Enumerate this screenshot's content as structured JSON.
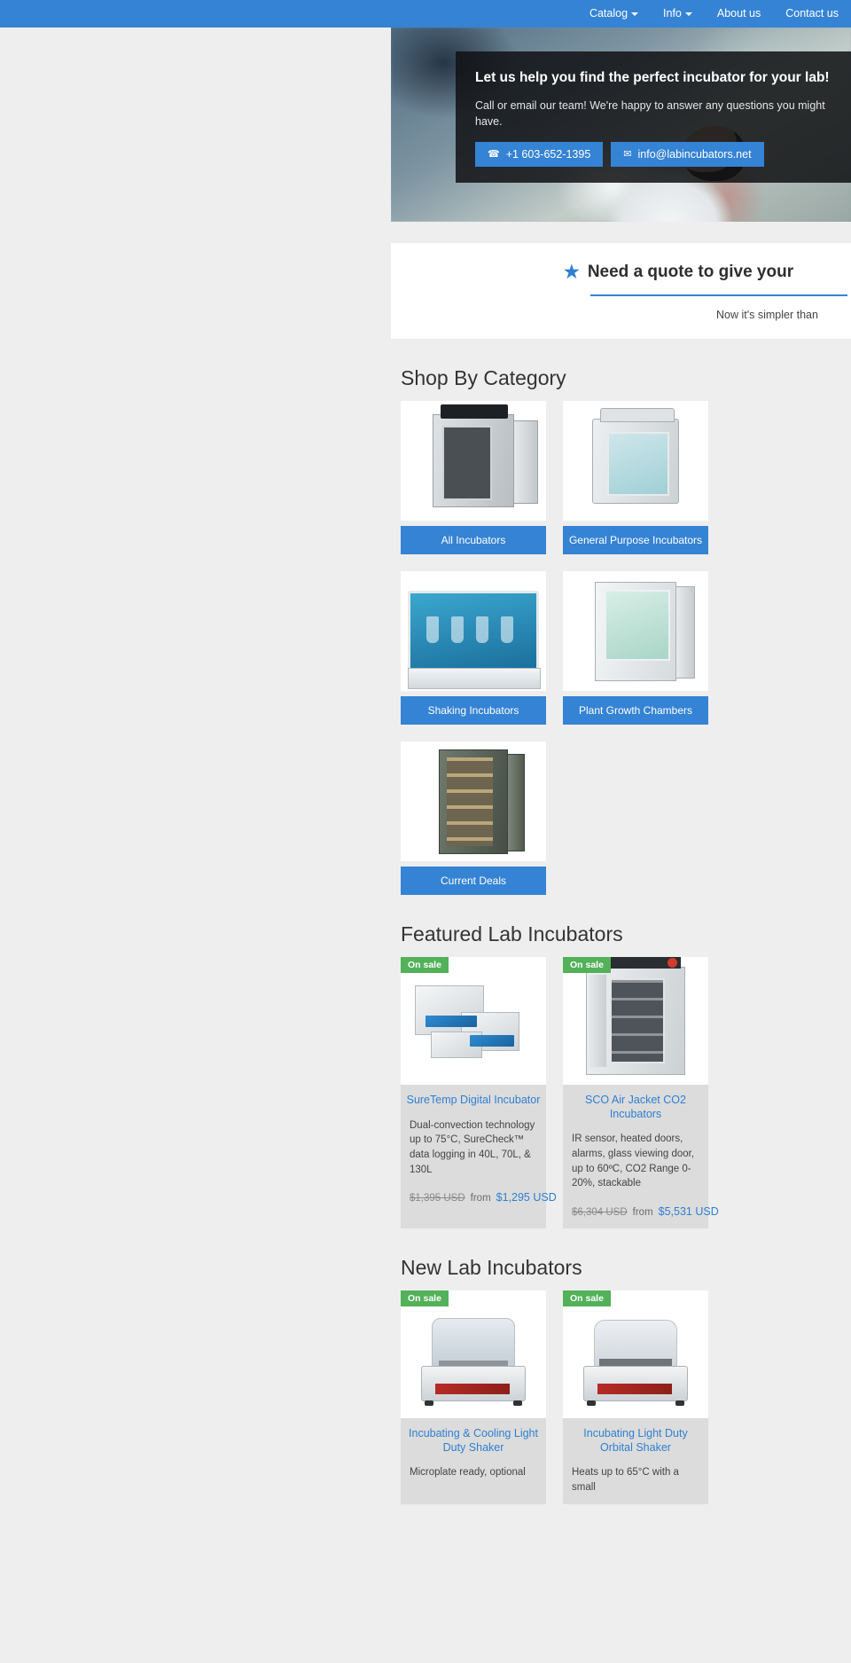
{
  "nav": {
    "items": [
      {
        "label": "Catalog",
        "has_caret": true
      },
      {
        "label": "Info",
        "has_caret": true
      },
      {
        "label": "About us",
        "has_caret": false
      },
      {
        "label": "Contact us",
        "has_caret": false
      }
    ]
  },
  "hero": {
    "title": "Let us help you find the perfect incubator for your lab!",
    "subtitle": "Call or email our team! We're happy to answer any questions you might have.",
    "phone_icon": "phone-icon",
    "phone_label": "+1 603-652-1395",
    "email_icon": "envelope-icon",
    "email_label": "info@labincubators.net"
  },
  "quote": {
    "star_icon": "star-icon",
    "heading": "Need a quote to give your",
    "subtext": "Now it's simpler than"
  },
  "categories": {
    "title": "Shop By Category",
    "items": [
      {
        "label": "All Incubators",
        "art": "a"
      },
      {
        "label": "General Purpose Incubators",
        "art": "b"
      },
      {
        "label": "Shaking Incubators",
        "art": "c"
      },
      {
        "label": "Plant Growth Chambers",
        "art": "d"
      },
      {
        "label": "Current Deals",
        "art": "e"
      }
    ]
  },
  "featured": {
    "title": "Featured Lab Incubators",
    "items": [
      {
        "badge": "On sale",
        "name": "SureTemp Digital Incubator",
        "description": "Dual-convection technology up to 75°C, SureCheck™ data logging in 40L, 70L, & 130L",
        "was": "$1,395 USD",
        "from": "from",
        "price": "$1,295 USD",
        "art": "1"
      },
      {
        "badge": "On sale",
        "name": "SCO Air Jacket CO2 Incubators",
        "description": "IR sensor, heated doors, alarms, glass viewing door, up to 60ºC, CO2 Range 0-20%, stackable",
        "was": "$6,304 USD",
        "from": "from",
        "price": "$5,531 USD",
        "art": "2"
      }
    ]
  },
  "newproducts": {
    "title": "New Lab Incubators",
    "items": [
      {
        "badge": "On sale",
        "name": "Incubating & Cooling Light Duty Shaker",
        "description": "Microplate ready, optional",
        "art": "3"
      },
      {
        "badge": "On sale",
        "name": "Incubating Light Duty Orbital Shaker",
        "description": "Heats up to 65°C with a small",
        "art": "4"
      }
    ]
  }
}
